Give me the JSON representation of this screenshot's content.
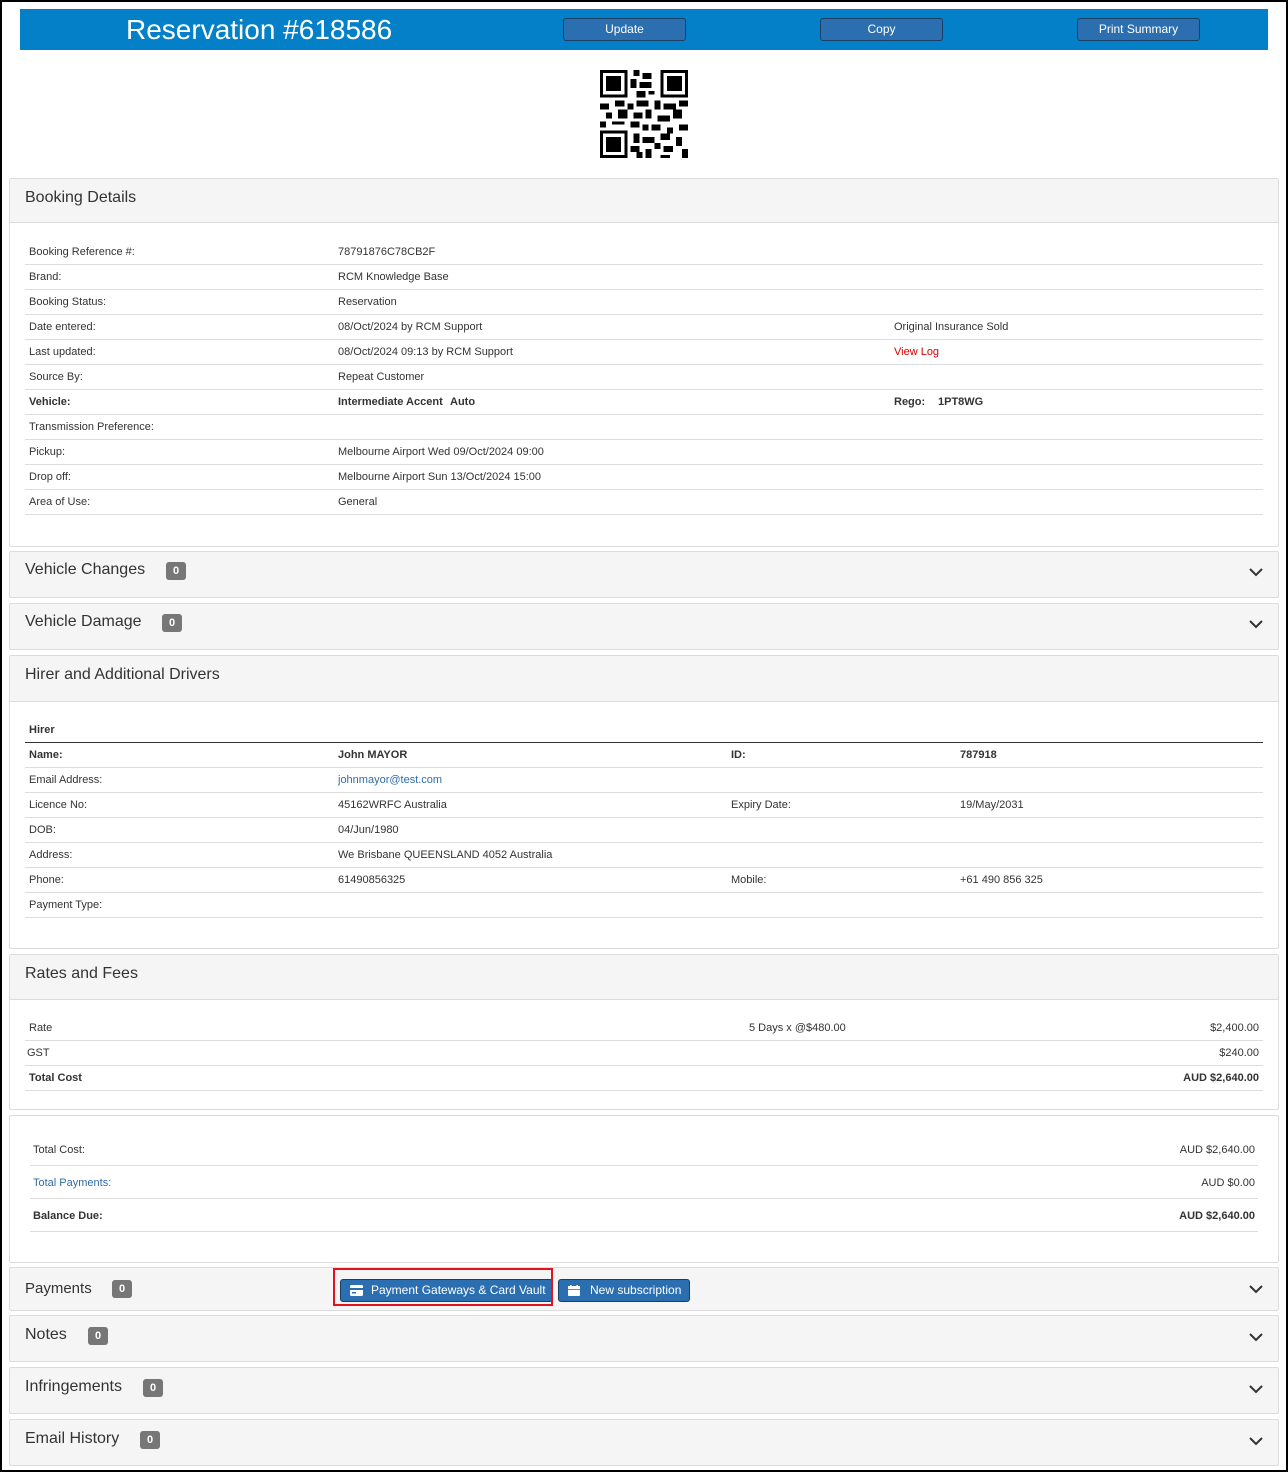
{
  "header": {
    "title": "Reservation #618586",
    "buttons": {
      "update": "Update",
      "copy": "Copy",
      "print": "Print Summary"
    }
  },
  "booking": {
    "title": "Booking Details",
    "reference_label": "Booking Reference #:",
    "reference": "78791876C78CB2F",
    "brand_label": "Brand:",
    "brand": "RCM Knowledge Base",
    "status_label": "Booking Status:",
    "status": "Reservation",
    "entered_label": "Date entered:",
    "entered": "08/Oct/2024 by RCM Support",
    "insurance_note": "Original Insurance Sold",
    "updated_label": "Last updated:",
    "updated": "08/Oct/2024 09:13 by RCM Support",
    "view_log": "View Log",
    "source_label": "Source By:",
    "source": "Repeat Customer",
    "vehicle_label": "Vehicle:",
    "vehicle": "Intermediate Accent",
    "vehicle_trans": "Auto",
    "rego_label": "Rego:",
    "rego": "1PT8WG",
    "transmission_label": "Transmission Preference:",
    "pickup_label": "Pickup:",
    "pickup": "Melbourne Airport Wed 09/Oct/2024 09:00",
    "dropoff_label": "Drop off:",
    "dropoff": "Melbourne Airport Sun 13/Oct/2024 15:00",
    "area_label": "Area of Use:",
    "area": "General"
  },
  "vehicle_changes": {
    "title": "Vehicle Changes",
    "count": "0"
  },
  "vehicle_damage": {
    "title": "Vehicle Damage",
    "count": "0"
  },
  "hirer": {
    "title": "Hirer and Additional Drivers",
    "section": "Hirer",
    "name_label": "Name:",
    "name": "John MAYOR",
    "id_label": "ID:",
    "id": "787918",
    "email_label": "Email Address:",
    "email": "johnmayor@test.com",
    "licence_label": "Licence No:",
    "licence": "45162WRFC Australia",
    "expiry_label": "Expiry Date:",
    "expiry": "19/May/2031",
    "dob_label": "DOB:",
    "dob": "04/Jun/1980",
    "address_label": "Address:",
    "address": "We Brisbane QUEENSLAND 4052 Australia",
    "phone_label": "Phone:",
    "phone": "61490856325",
    "mobile_label": "Mobile:",
    "mobile": "+61 490 856 325",
    "payment_type_label": "Payment Type:"
  },
  "rates": {
    "title": "Rates and Fees",
    "rate_label": "Rate",
    "rate_detail": "5 Days x @$480.00",
    "rate_amount": "$2,400.00",
    "gst_label": "GST",
    "gst_amount": "$240.00",
    "total_label": "Total Cost",
    "total_amount": "AUD $2,640.00"
  },
  "summary": {
    "total_cost_label": "Total Cost:",
    "total_cost": "AUD $2,640.00",
    "total_payments_label": "Total Payments:",
    "total_payments": "AUD $0.00",
    "balance_label": "Balance Due:",
    "balance": "AUD $2,640.00"
  },
  "payments": {
    "title": "Payments",
    "count": "0",
    "gateway_button": "Payment Gateways & Card Vault",
    "subscription_button": "New subscription"
  },
  "notes": {
    "title": "Notes",
    "count": "0"
  },
  "infringements": {
    "title": "Infringements",
    "count": "0"
  },
  "email_history": {
    "title": "Email History",
    "count": "0"
  },
  "icons": {
    "qr": "qr-code-icon",
    "chevron": "chevron-down-icon",
    "card": "credit-card-icon",
    "calendar": "calendar-icon"
  },
  "colors": {
    "header": "#0380c7",
    "button": "#2c6fb0",
    "badge": "#777777",
    "highlight": "#e0141e",
    "link": "#2f6ca6",
    "alert": "#d90000"
  }
}
